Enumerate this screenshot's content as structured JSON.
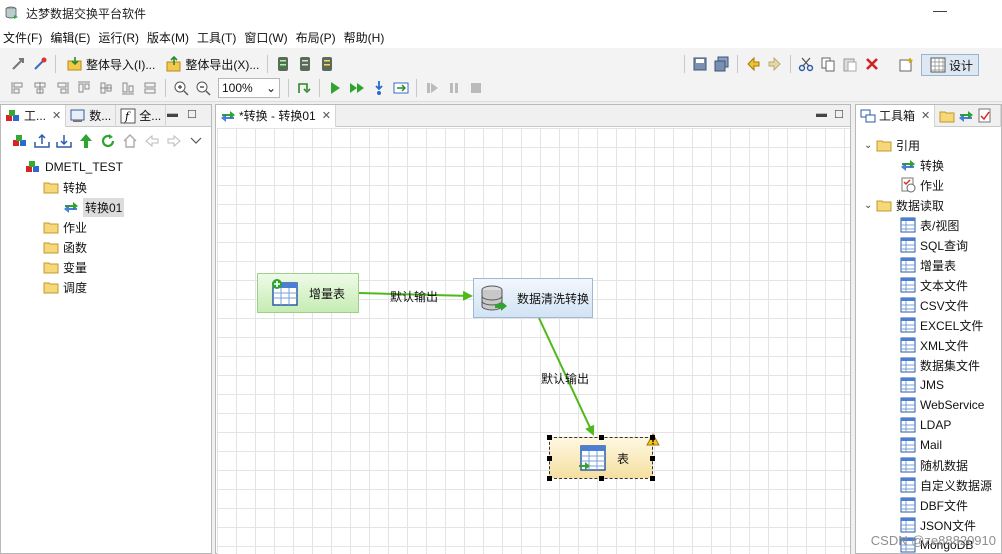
{
  "window": {
    "title": "达梦数据交换平台软件",
    "minimize_glyph": "—"
  },
  "menubar": [
    "文件(F)",
    "编辑(E)",
    "运行(R)",
    "版本(M)",
    "工具(T)",
    "窗口(W)",
    "布局(P)",
    "帮助(H)"
  ],
  "toolbar": {
    "import_all": "整体导入(I)...",
    "export_all": "整体导出(X)...",
    "zoom": "100%",
    "design": "设计"
  },
  "left_panel": {
    "tabs": [
      "工...",
      "数...",
      "全..."
    ],
    "tree": {
      "root": "DMETL_TEST",
      "items": [
        {
          "label": "转换",
          "level": 1
        },
        {
          "label": "转换01",
          "level": 2,
          "selected": true
        },
        {
          "label": "作业",
          "level": 1
        },
        {
          "label": "函数",
          "level": 1
        },
        {
          "label": "变量",
          "level": 1
        },
        {
          "label": "调度",
          "level": 1
        }
      ]
    }
  },
  "editor": {
    "tab_label": "*转换 - 转换01",
    "nodes": {
      "incremental": "增量表",
      "cleanse": "数据清洗转换",
      "table": "表"
    },
    "edges": [
      "默认输出",
      "默认输出"
    ]
  },
  "toolbox": {
    "tab_label": "工具箱",
    "sections": [
      {
        "label": "引用",
        "items": [
          "转换",
          "作业"
        ]
      },
      {
        "label": "数据读取",
        "items": [
          "表/视图",
          "SQL查询",
          "增量表",
          "文本文件",
          "CSV文件",
          "EXCEL文件",
          "XML文件",
          "数据集文件",
          "JMS",
          "WebService",
          "LDAP",
          "Mail",
          "随机数据",
          "自定义数据源",
          "DBF文件",
          "JSON文件",
          "MongoDB"
        ]
      }
    ]
  },
  "watermark": "CSDN @ze88820910",
  "colors": {
    "edge_green": "#4fb81a",
    "selection": "#000000"
  }
}
